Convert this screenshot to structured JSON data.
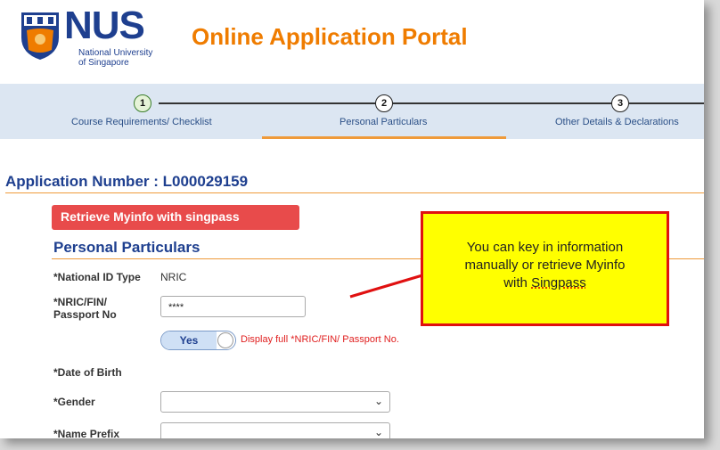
{
  "header": {
    "logo_big": "NUS",
    "logo_line1": "National University",
    "logo_line2": "of Singapore",
    "portal_title": "Online Application Portal"
  },
  "steps": [
    {
      "num": "1",
      "label": "Course Requirements/ Checklist"
    },
    {
      "num": "2",
      "label": "Personal Particulars"
    },
    {
      "num": "3",
      "label": "Other Details & Declarations"
    }
  ],
  "application": {
    "number_label": "Application Number : L000029159"
  },
  "myinfo_button": "Retrieve Myinfo with singpass",
  "section_title": "Personal Particulars",
  "fields": {
    "national_id_type_label": "*National ID Type",
    "national_id_type_value": "NRIC",
    "nric_label_1": "*NRIC/FIN/",
    "nric_label_2": "Passport No",
    "nric_value": "****",
    "toggle_label": "Yes",
    "toggle_text": "Display full *NRIC/FIN/ Passport No.",
    "dob_label": "*Date of Birth",
    "gender_label": "*Gender",
    "name_prefix_label": "*Name Prefix"
  },
  "callout": {
    "line1": "You can key in information",
    "line2": "manually or retrieve Myinfo",
    "line3_pre": "with ",
    "line3_u": "Singpass"
  },
  "colors": {
    "brand_blue": "#1e3f8f",
    "brand_orange": "#ef7c00",
    "callout_bg": "#ffff00",
    "callout_border": "#e01010"
  }
}
